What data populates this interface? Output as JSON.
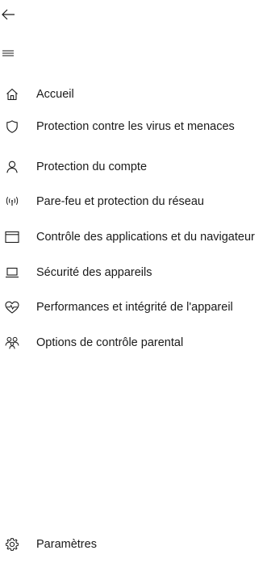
{
  "header": {
    "back_icon": "back-arrow-icon",
    "menu_icon": "hamburger-menu-icon"
  },
  "nav": {
    "items": [
      {
        "label": "Accueil",
        "icon": "home-icon"
      },
      {
        "label": "Protection contre les virus et menaces",
        "icon": "shield-icon"
      },
      {
        "label": "Protection du compte",
        "icon": "person-icon"
      },
      {
        "label": "Pare-feu et protection du réseau",
        "icon": "wireless-icon"
      },
      {
        "label": "Contrôle des applications et du navigateur",
        "icon": "app-browser-icon"
      },
      {
        "label": "Sécurité des appareils",
        "icon": "laptop-icon"
      },
      {
        "label": "Performances et intégrité de l'appareil",
        "icon": "heart-pulse-icon"
      },
      {
        "label": "Options de contrôle parental",
        "icon": "family-icon"
      }
    ],
    "settings": {
      "label": "Paramètres",
      "icon": "gear-icon"
    }
  },
  "colors": {
    "background": "#ffffff",
    "text": "#1a1a1a",
    "icon": "#1a1a1a"
  }
}
